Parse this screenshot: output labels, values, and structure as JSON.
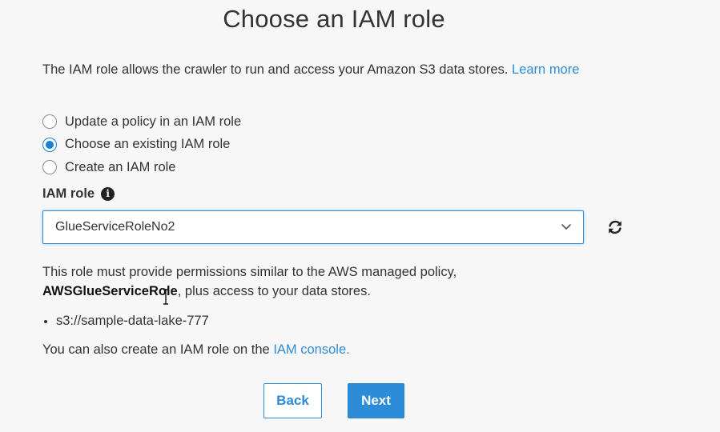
{
  "title": "Choose an IAM role",
  "description": {
    "text": "The IAM role allows the crawler to run and access your Amazon S3 data stores. ",
    "learn_more": "Learn more"
  },
  "options": [
    {
      "label": "Update a policy in an IAM role",
      "checked": false
    },
    {
      "label": "Choose an existing IAM role",
      "checked": true
    },
    {
      "label": "Create an IAM role",
      "checked": false
    }
  ],
  "iam_role": {
    "label": "IAM role",
    "info_icon": "info-icon",
    "selected": "GlueServiceRoleNo2",
    "chevron_icon": "chevron-down-icon",
    "refresh_icon": "refresh-icon"
  },
  "note": {
    "line1": "This role must provide permissions similar to the AWS managed policy,",
    "policy_name": "AWSGlueServiceRole",
    "line2_suffix": ", plus access to your data stores."
  },
  "data_stores": [
    "s3://sample-data-lake-777"
  ],
  "footer": {
    "prefix": "You can also create an IAM role on the ",
    "link": "IAM console",
    "suffix": "."
  },
  "buttons": {
    "back": "Back",
    "next": "Next"
  },
  "colors": {
    "accent": "#2c8cd8",
    "background": "#f7f7f7"
  }
}
